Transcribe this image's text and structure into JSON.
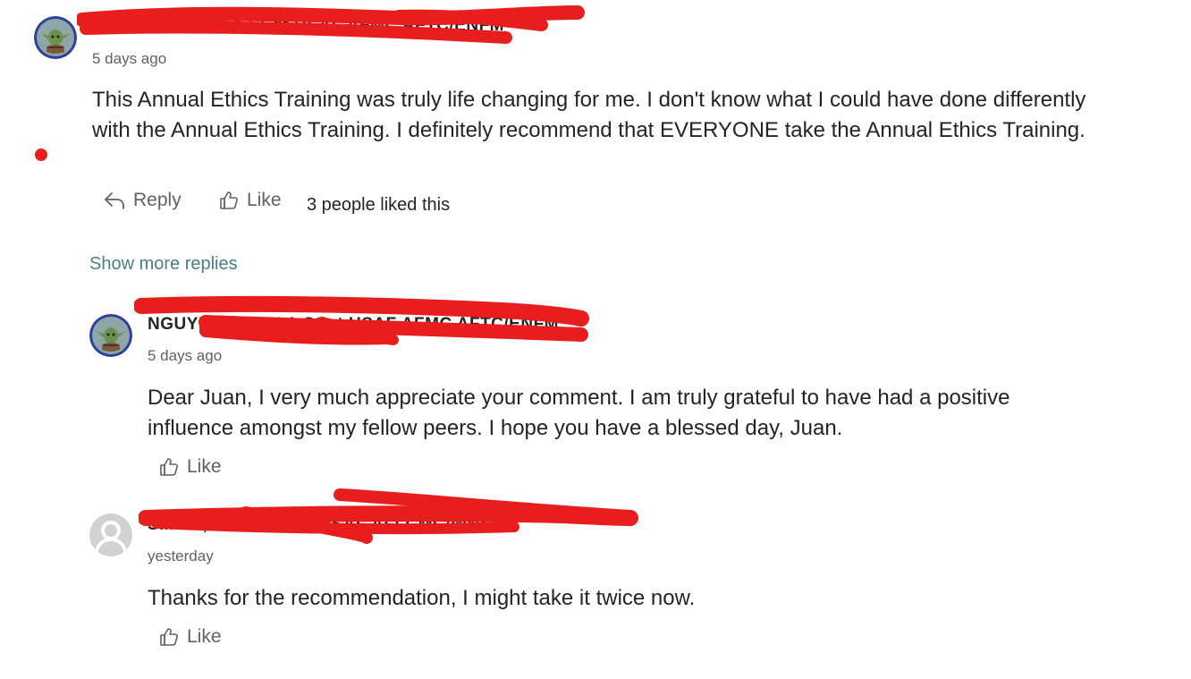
{
  "comment": {
    "author": "NGUYEN, JUAN A SSgt USAF AFMC AFTC/ENFM",
    "time": "5 days ago",
    "text": "This Annual Ethics Training was truly life changing for me. I don't know what I could have done differently with the Annual Ethics Training. I definitely recommend that EVERYONE take the Annual Ethics Training.",
    "reply_label": "Reply",
    "like_label": "Like",
    "like_count": "3 people liked this",
    "unread_color": "#e81e1e"
  },
  "show_more_replies": "Show more replies",
  "replies": [
    {
      "author": "NGUYEN, JUAN A SSgt USAF AFMC AFTC/ENFM",
      "time": "5 days ago",
      "text": "Dear Juan, I very much appreciate your comment. I am truly grateful to have had a positive influence amongst my fellow peers. I hope you have a blessed day, Juan.",
      "like_label": "Like",
      "avatar": "yoda-avatar"
    },
    {
      "author": "SMITH, JOHN A CIV USAF AFLCMC/WNS",
      "time": "yesterday",
      "text": "Thanks for the recommendation, I might take it twice now.",
      "like_label": "Like",
      "avatar": "default-person-avatar"
    }
  ],
  "colors": {
    "redaction": "#e81e1e",
    "link": "#4a7f86",
    "secondary_text": "#616161"
  }
}
